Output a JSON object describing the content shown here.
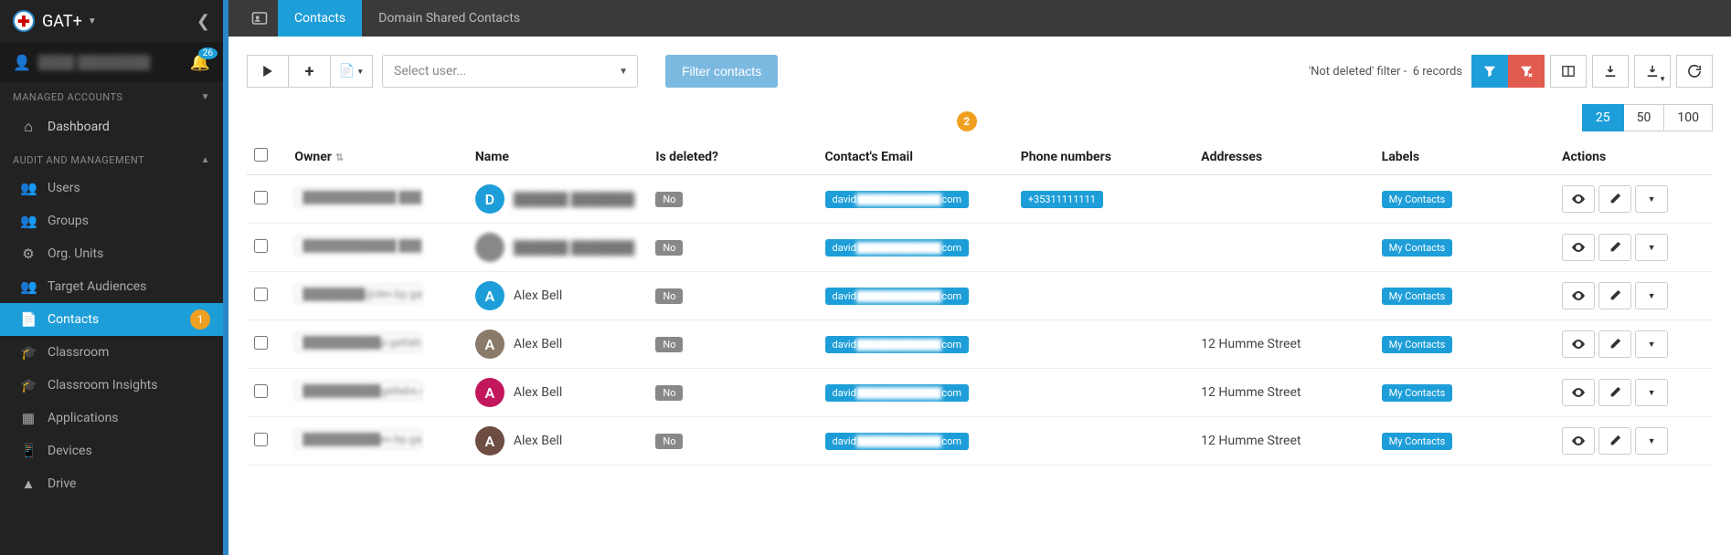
{
  "brand": {
    "title": "GAT+",
    "notif_count": "26",
    "user_name_blurred": "████ ████████"
  },
  "sidebar": {
    "section_managed": "MANAGED ACCOUNTS",
    "dashboard": "Dashboard",
    "section_audit": "AUDIT AND MANAGEMENT",
    "items": [
      {
        "label": "Users"
      },
      {
        "label": "Groups"
      },
      {
        "label": "Org. Units"
      },
      {
        "label": "Target Audiences"
      },
      {
        "label": "Contacts"
      },
      {
        "label": "Classroom"
      },
      {
        "label": "Classroom Insights"
      },
      {
        "label": "Applications"
      },
      {
        "label": "Devices"
      },
      {
        "label": "Drive"
      }
    ],
    "marker1": "1"
  },
  "topbar": {
    "tab_contacts": "Contacts",
    "tab_domain": "Domain Shared Contacts"
  },
  "toolbar": {
    "select_user_placeholder": "Select user...",
    "filter_btn": "Filter contacts",
    "filter_meta_prefix": "'Not deleted' filter -",
    "record_count": "6 records"
  },
  "pager": {
    "p25": "25",
    "p50": "50",
    "p100": "100"
  },
  "table": {
    "headers": {
      "owner": "Owner",
      "name": "Name",
      "deleted": "Is deleted?",
      "email": "Contact's Email",
      "phone": "Phone numbers",
      "addresses": "Addresses",
      "labels": "Labels",
      "actions": "Actions"
    },
    "marker2": "2",
    "rows": [
      {
        "owner_blur": "████████████ ████████",
        "avatar_letter": "D",
        "avatar_color": "#1e9ed8",
        "name": "██████ ███████",
        "name_blur": true,
        "deleted": "No",
        "email_prefix": "david",
        "email_suffix": "com",
        "phone": "+35311111111",
        "address": "",
        "label": "My Contacts"
      },
      {
        "owner_blur": "████████████ ████████",
        "avatar_letter": "",
        "avatar_color": "#555",
        "avatar_img": true,
        "name": "██████ ███████",
        "name_blur": true,
        "deleted": "No",
        "email_prefix": "david",
        "email_suffix": "com",
        "phone": "",
        "address": "",
        "label": "My Contacts"
      },
      {
        "owner_blur": "████████@dev.bp.gatlabs....",
        "avatar_letter": "A",
        "avatar_color": "#1e9ed8",
        "name": "Alex Bell",
        "name_blur": false,
        "deleted": "No",
        "email_prefix": "david",
        "email_suffix": "com",
        "phone": "",
        "address": "",
        "label": "My Contacts"
      },
      {
        "owner_blur": "██████████p.gatlabs.com",
        "avatar_letter": "A",
        "avatar_color": "#8a7a6a",
        "name": "Alex Bell",
        "name_blur": false,
        "deleted": "No",
        "email_prefix": "david",
        "email_suffix": "com",
        "phone": "",
        "address": "12 Humme Street",
        "label": "My Contacts"
      },
      {
        "owner_blur": "██████████gatlabs.com",
        "avatar_letter": "A",
        "avatar_color": "#c2185b",
        "name": "Alex Bell",
        "name_blur": false,
        "deleted": "No",
        "email_prefix": "david",
        "email_suffix": "com",
        "phone": "",
        "address": "12 Humme Street",
        "label": "My Contacts"
      },
      {
        "owner_blur": "██████████ev.bp.gatlabs....",
        "avatar_letter": "A",
        "avatar_color": "#6d4c41",
        "name": "Alex Bell",
        "name_blur": false,
        "deleted": "No",
        "email_prefix": "david",
        "email_suffix": "com",
        "phone": "",
        "address": "12 Humme Street",
        "label": "My Contacts"
      }
    ]
  }
}
